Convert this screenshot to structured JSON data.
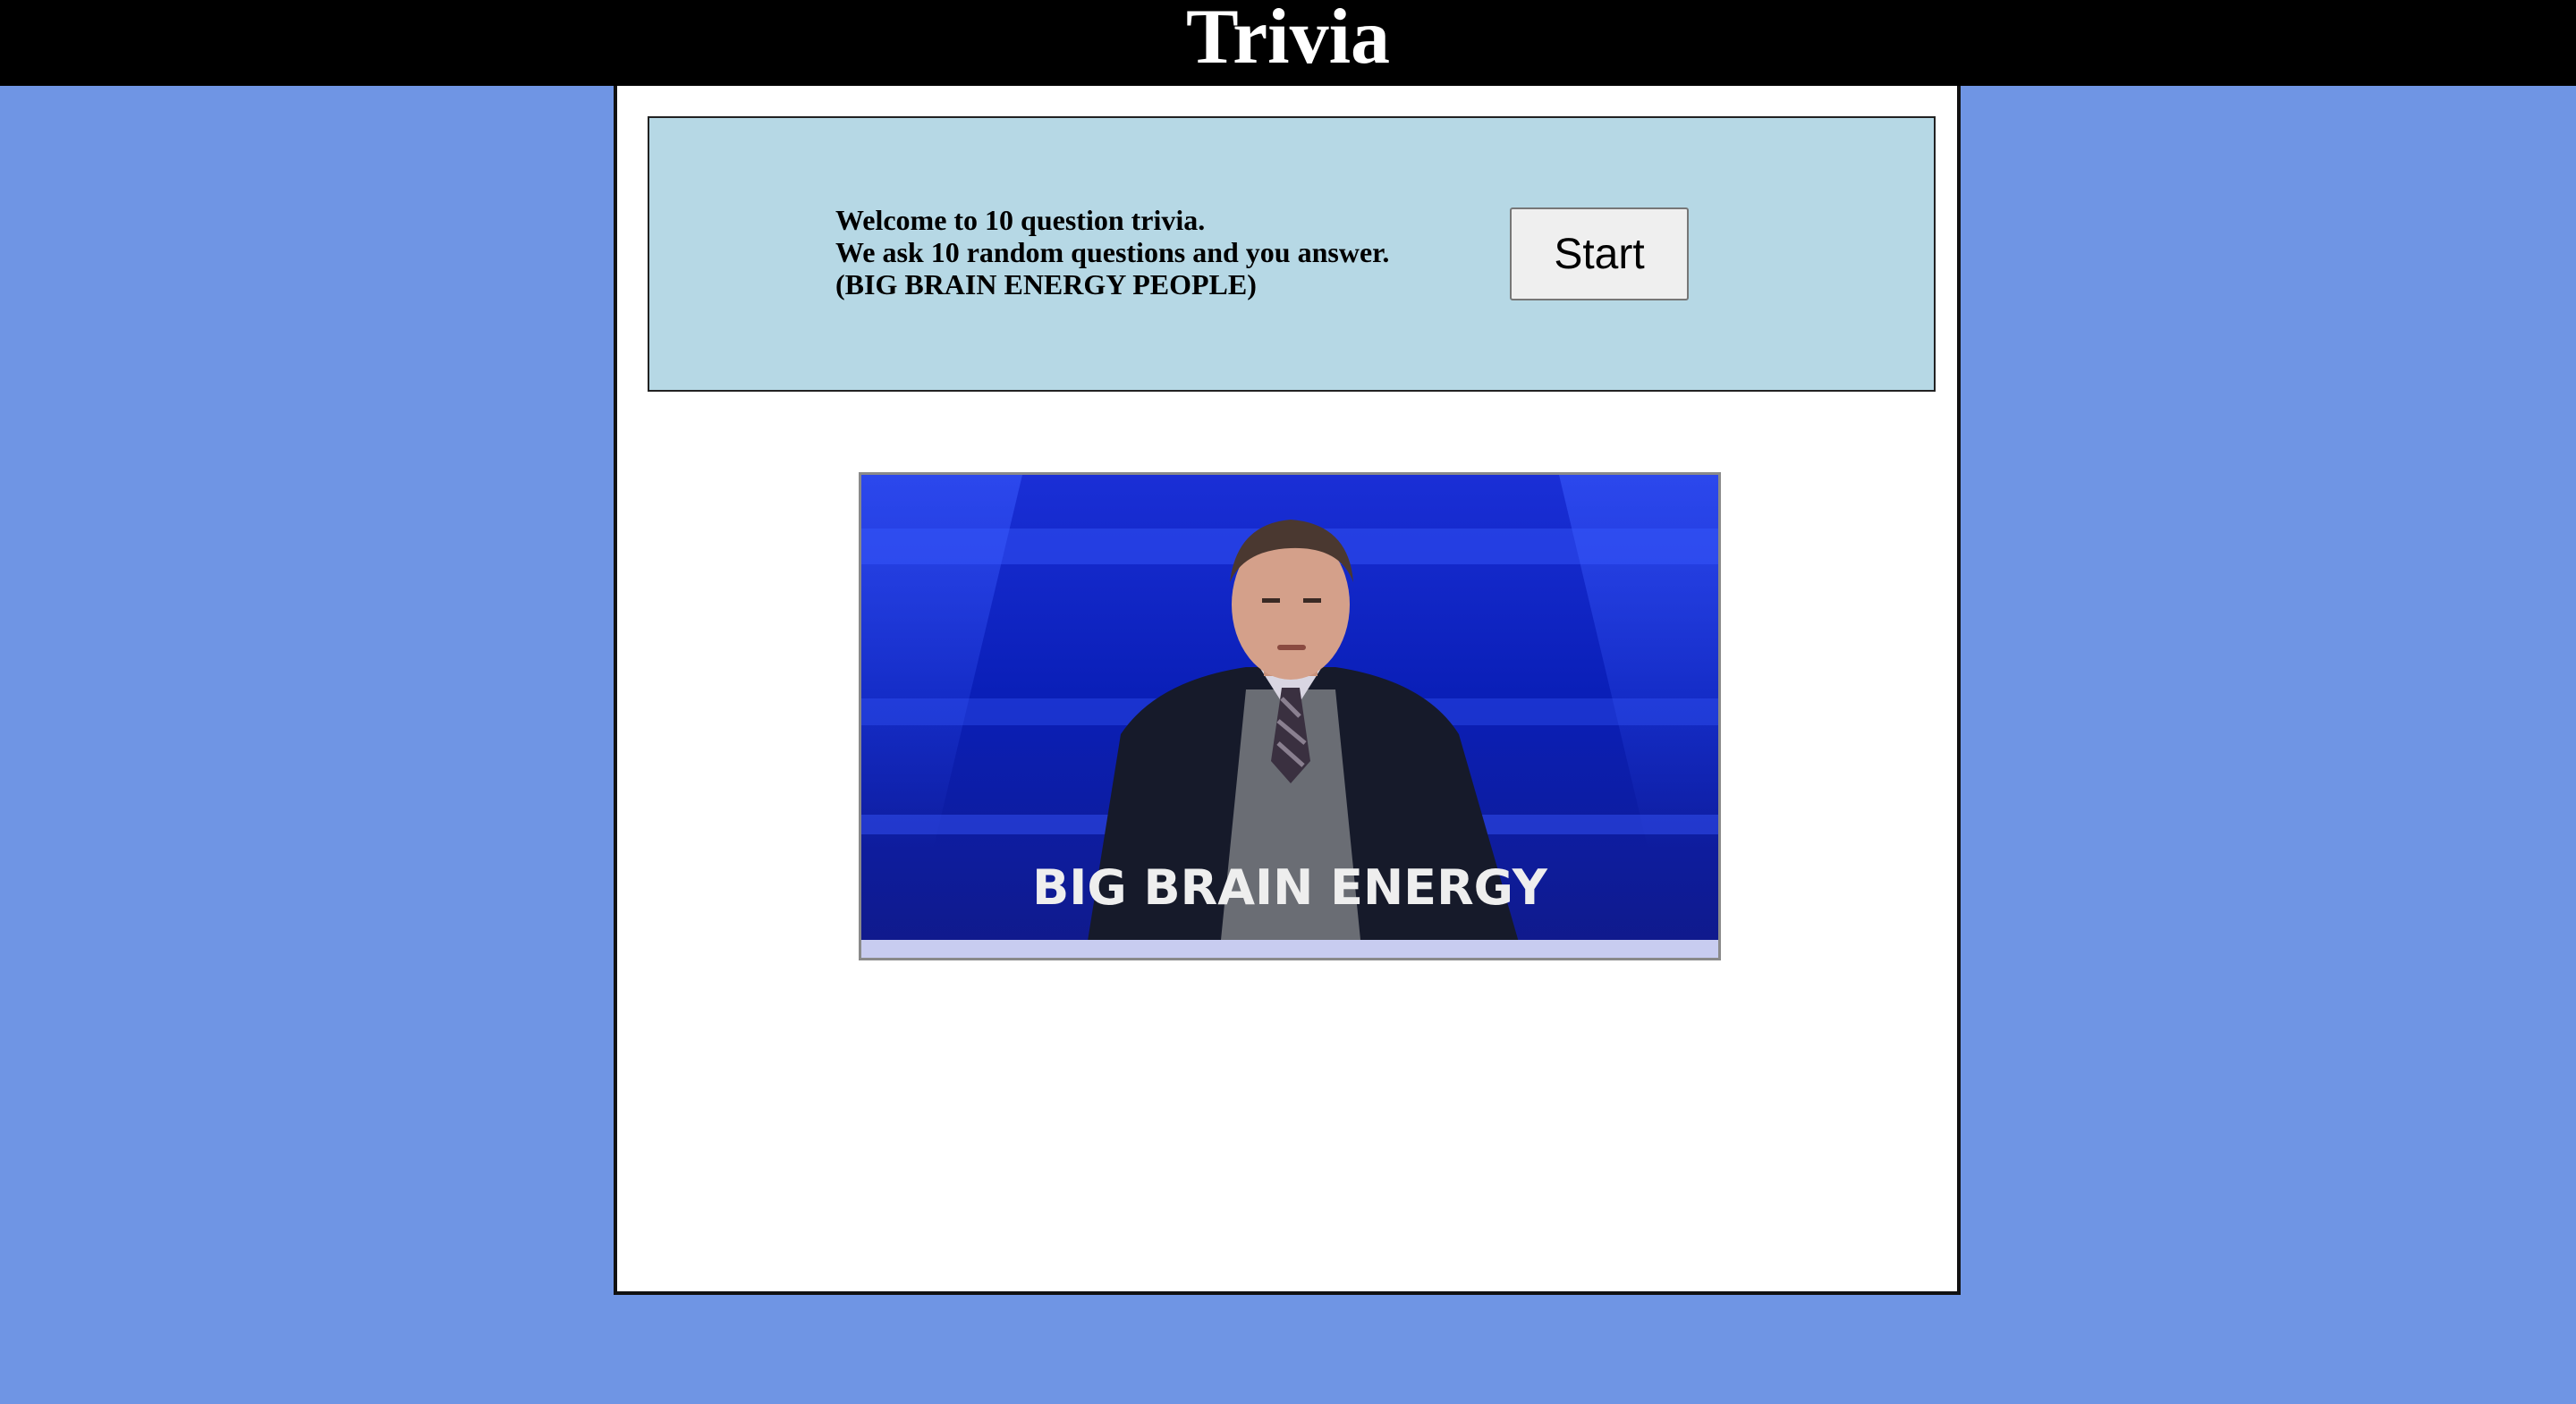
{
  "header": {
    "title": "Trivia"
  },
  "welcome": {
    "line1": "Welcome to 10 question trivia.",
    "line2": "We ask 10 random questions and you answer.",
    "line3": "(BIG BRAIN ENERGY PEOPLE)"
  },
  "start_button": {
    "label": "Start"
  },
  "gif": {
    "caption": "BIG BRAIN ENERGY"
  },
  "colors": {
    "background": "#6f95e4",
    "header": "#000000",
    "welcome_box": "#b6d8e5",
    "panel": "#ffffff"
  }
}
